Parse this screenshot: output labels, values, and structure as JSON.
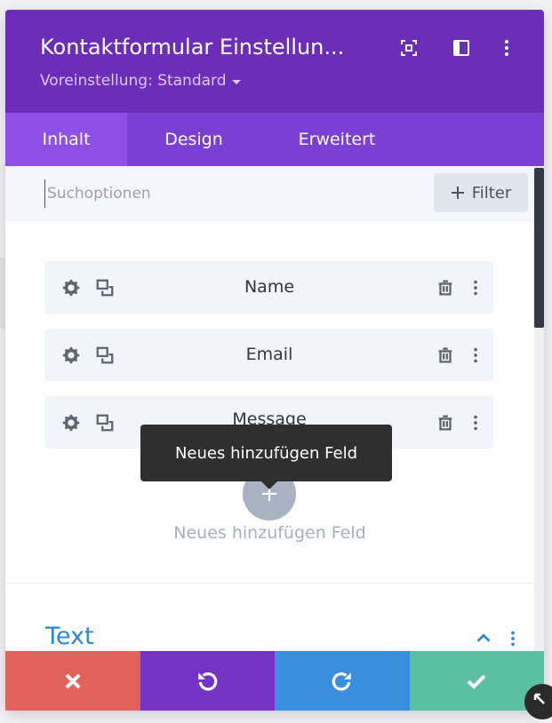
{
  "header": {
    "title": "Kontaktformular Einstellun...",
    "preset_label": "Voreinstellung: Standard",
    "icons": [
      "focus-icon",
      "sidebar-toggle-icon",
      "more-vert-icon"
    ],
    "color": "#6c2eb9"
  },
  "tabs": [
    {
      "label": "Inhalt",
      "active": true
    },
    {
      "label": "Design",
      "active": false
    },
    {
      "label": "Erweitert",
      "active": false
    }
  ],
  "search": {
    "placeholder": "Suchoptionen",
    "filter_label": "Filter",
    "filter_icon": "plus-icon"
  },
  "fields": [
    {
      "label": "Name"
    },
    {
      "label": "Email"
    },
    {
      "label": "Message"
    }
  ],
  "field_icons": [
    "gear-icon",
    "duplicate-icon",
    "trash-icon",
    "more-vert-icon"
  ],
  "tooltip": {
    "text": "Neues hinzufügen Feld"
  },
  "add_field": {
    "label": "Neues hinzufügen Feld",
    "icon": "plus-icon"
  },
  "section": {
    "title": "Text",
    "icons": [
      "chevron-up-icon",
      "more-vert-icon"
    ]
  },
  "actions": [
    {
      "name": "cancel",
      "icon": "close-icon",
      "color": "#e1625a"
    },
    {
      "name": "undo",
      "icon": "undo-icon",
      "color": "#7433c3"
    },
    {
      "name": "redo",
      "icon": "redo-icon",
      "color": "#3b8ede"
    },
    {
      "name": "save",
      "icon": "check-icon",
      "color": "#5bc0a0"
    }
  ]
}
